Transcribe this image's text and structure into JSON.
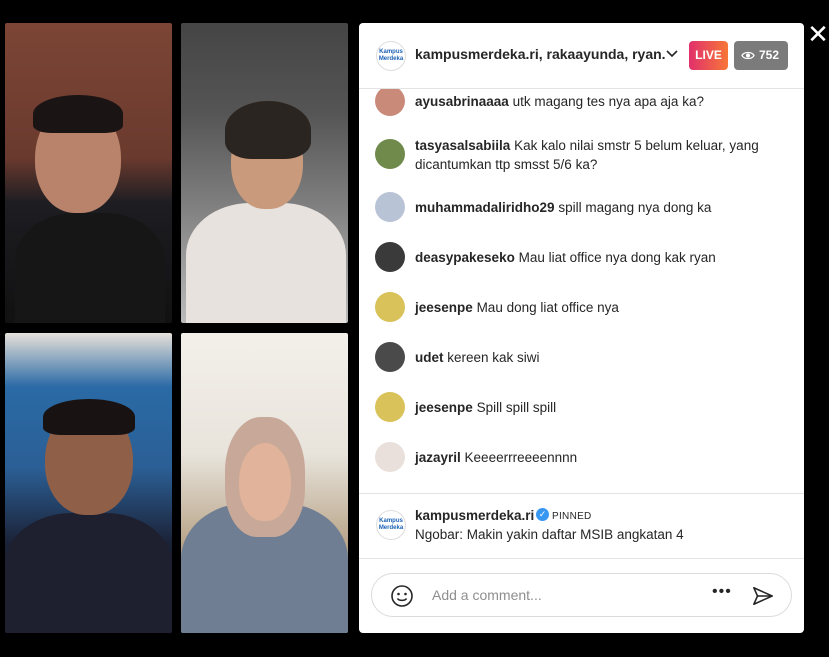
{
  "header": {
    "title": "kampusmerdeka.ri, rakaayunda, ryan...",
    "logo_text": "Kampus Merdeka",
    "live_label": "LIVE",
    "viewer_count": "752"
  },
  "comments": [
    {
      "user": "ayusabrinaaaa",
      "text": "utk magang tes nya apa aja ka?",
      "avatar_color": "#c98a7a"
    },
    {
      "user": "tasyasalsabiila",
      "text": "Kak kalo nilai smstr 5 belum keluar, yang dicantumkan ttp smsst 5/6 ka?",
      "avatar_color": "#6f8a4a"
    },
    {
      "user": "muhammadaliridho29",
      "text": "spill magang nya dong ka",
      "avatar_color": "#b9c3d6"
    },
    {
      "user": "deasypakeseko",
      "text": "Mau liat office nya dong kak ryan",
      "avatar_color": "#3a3a3a"
    },
    {
      "user": "jeesenpe",
      "text": "Mau dong liat office nya",
      "avatar_color": "#d9c25a"
    },
    {
      "user": "udet",
      "text": "kereen kak siwi",
      "avatar_color": "#4a4a4a"
    },
    {
      "user": "jeesenpe",
      "text": "Spill spill spill",
      "avatar_color": "#d9c25a"
    },
    {
      "user": "jazayril",
      "text": "Keeeerrreeeennnn",
      "avatar_color": "#e9e0dc"
    }
  ],
  "pinned": {
    "user": "kampusmerdeka.ri",
    "tag": "PINNED",
    "text": "Ngobar: Makin yakin daftar MSIB angkatan 4"
  },
  "composer": {
    "placeholder": "Add a comment...",
    "more_label": "•••"
  },
  "icons": {
    "close": "close-icon",
    "eye": "eye-icon",
    "emoji": "emoji-icon",
    "send": "send-icon",
    "chevron": "chevron-down-icon",
    "verified": "verified-icon"
  },
  "colors": {
    "live_gradient_start": "#e1306c",
    "live_gradient_end": "#f77737",
    "verified": "#3897f0"
  }
}
